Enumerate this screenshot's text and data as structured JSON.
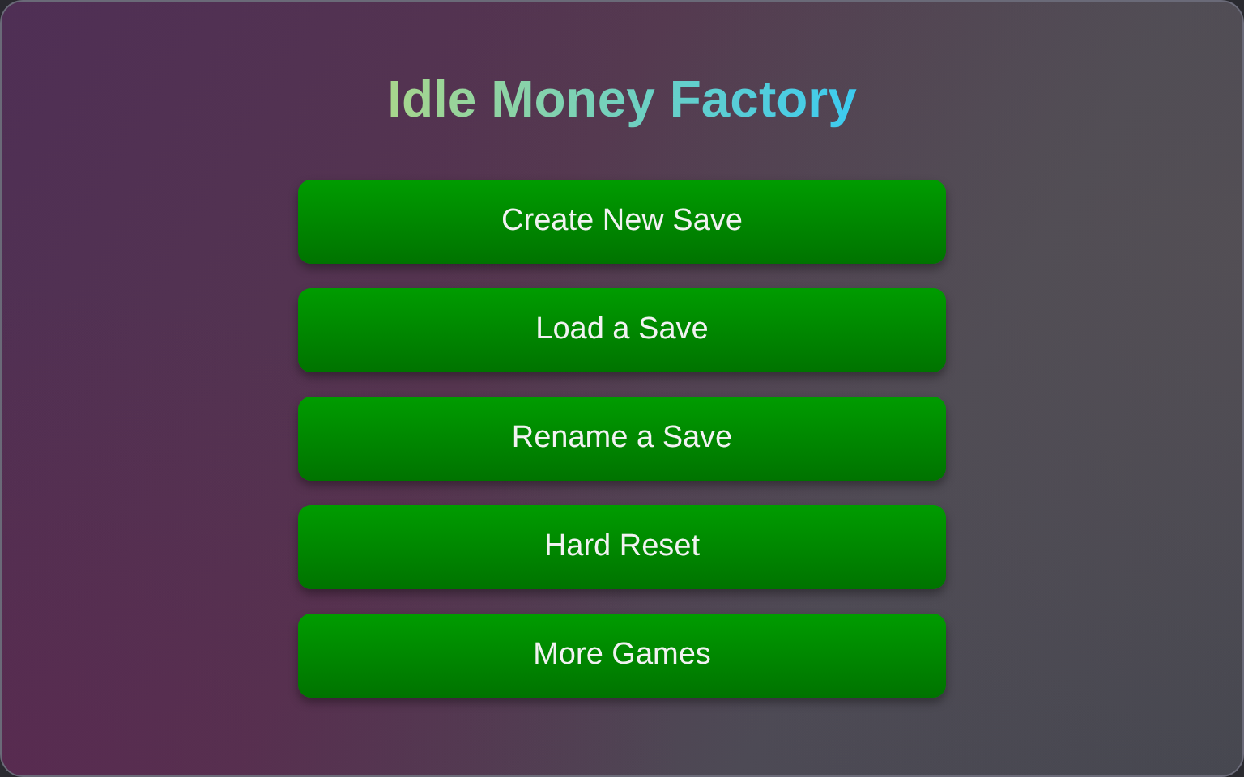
{
  "title": "Idle Money Factory",
  "buttons": [
    {
      "label": "Create New Save"
    },
    {
      "label": "Load a Save"
    },
    {
      "label": "Rename a Save"
    },
    {
      "label": "Hard Reset"
    },
    {
      "label": "More Games"
    }
  ]
}
